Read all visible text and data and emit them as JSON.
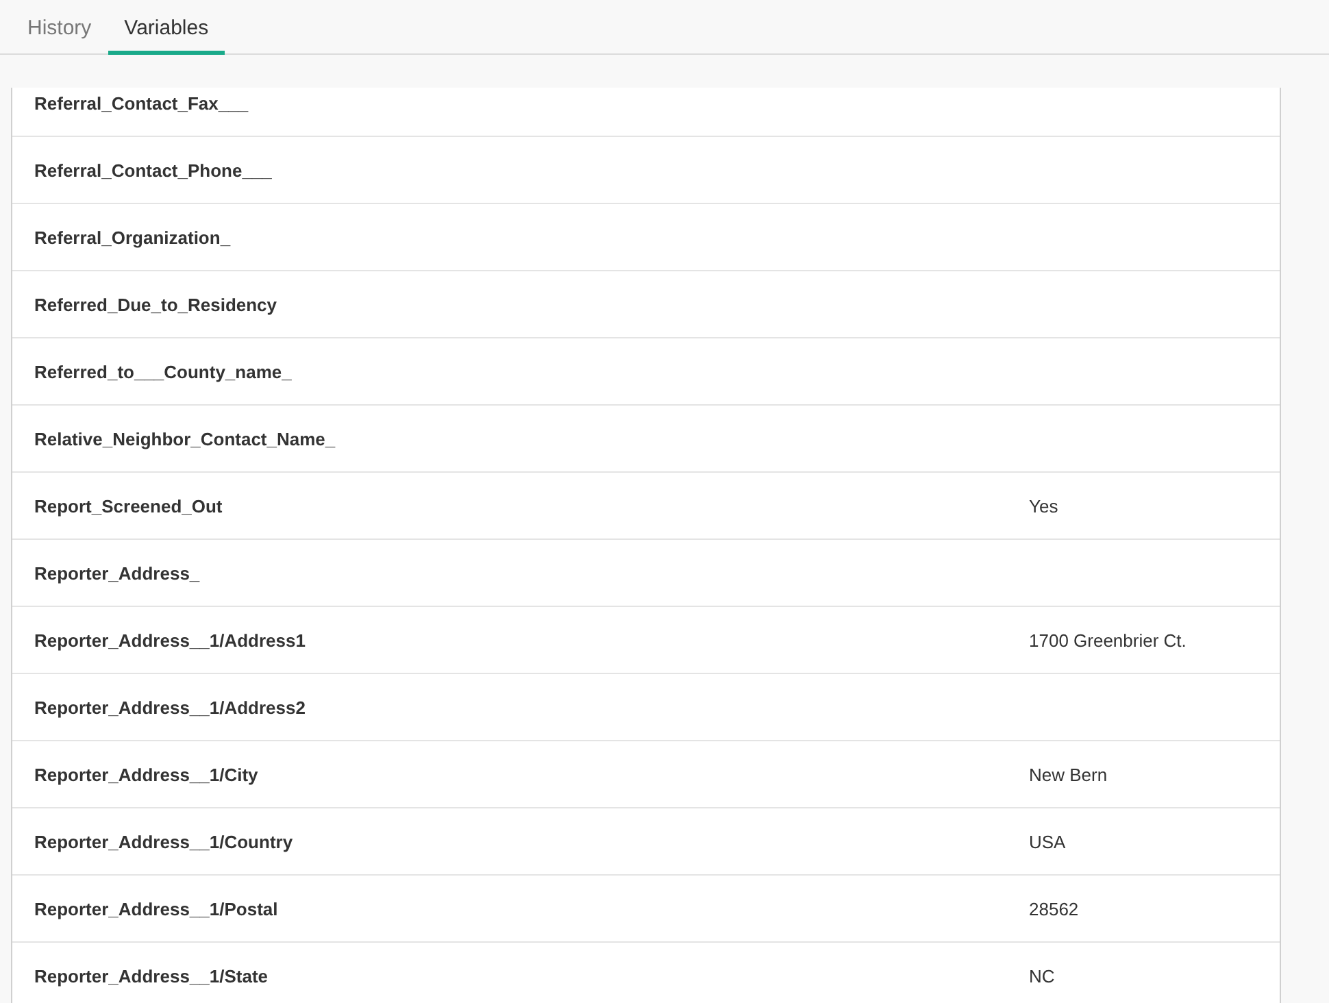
{
  "tabs": [
    {
      "label": "History",
      "selected": false
    },
    {
      "label": "Variables",
      "selected": true
    }
  ],
  "variables": [
    {
      "name": "Referral_Contact_Fax___"
    },
    {
      "name": "Referral_Contact_Phone___"
    },
    {
      "name": "Referral_Organization_"
    },
    {
      "name": "Referred_Due_to_Residency"
    },
    {
      "name": "Referred_to___County_name_"
    },
    {
      "name": "Relative_Neighbor_Contact_Name_"
    },
    {
      "name": "Report_Screened_Out",
      "value": "Yes"
    },
    {
      "name": "Reporter_Address_"
    },
    {
      "name": "Reporter_Address__1/Address1",
      "value": "1700 Greenbrier Ct."
    },
    {
      "name": "Reporter_Address__1/Address2"
    },
    {
      "name": "Reporter_Address__1/City",
      "value": "New Bern"
    },
    {
      "name": "Reporter_Address__1/Country",
      "value": "USA"
    },
    {
      "name": "Reporter_Address__1/Postal",
      "value": "28562"
    },
    {
      "name": "Reporter_Address__1/State",
      "value": "NC"
    }
  ]
}
